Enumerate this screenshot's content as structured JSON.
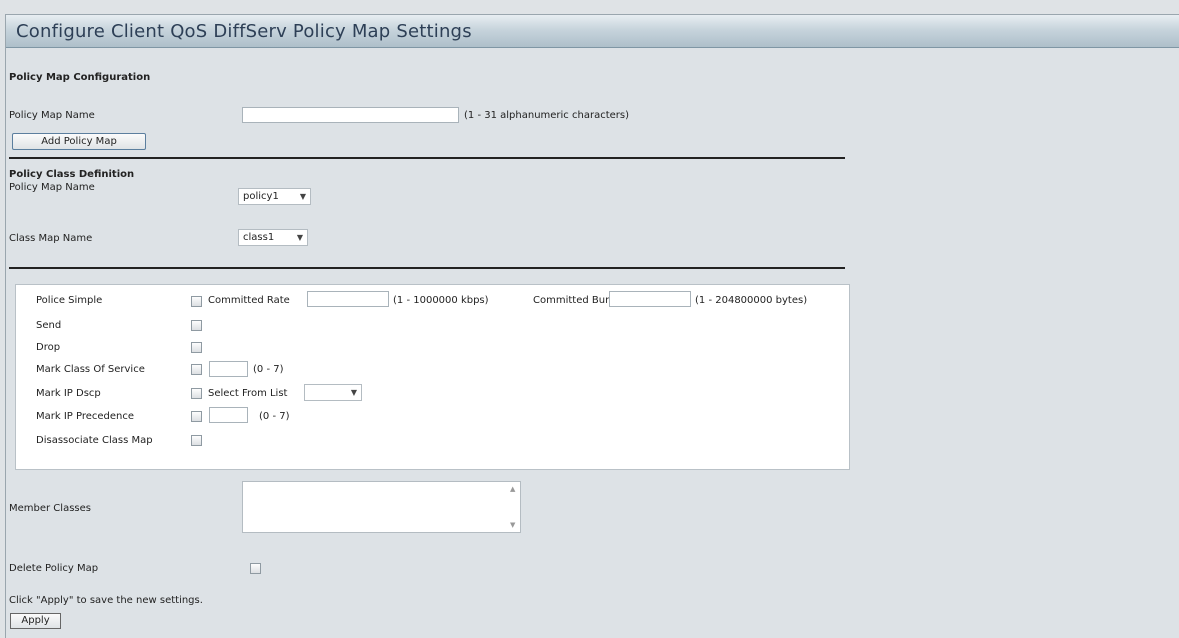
{
  "page": {
    "title": "Configure Client QoS DiffServ Policy Map Settings"
  },
  "policy_map_config": {
    "heading": "Policy Map Configuration",
    "name_label": "Policy Map Name",
    "name_value": "",
    "name_hint": "(1 - 31 alphanumeric characters)",
    "add_button": "Add Policy Map"
  },
  "class_definition": {
    "heading": "Policy Class Definition",
    "policy_label": "Policy Map Name",
    "policy_selected": "policy1",
    "class_label": "Class Map Name",
    "class_selected": "class1"
  },
  "actions": {
    "police_simple": {
      "label": "Police Simple",
      "committed_rate_label": "Committed Rate",
      "committed_rate_value": "",
      "committed_rate_hint": "(1 - 1000000 kbps)",
      "committed_burst_label": "Committed Burst",
      "committed_burst_value": "",
      "committed_burst_hint": "(1 - 204800000 bytes)"
    },
    "send": {
      "label": "Send"
    },
    "drop": {
      "label": "Drop"
    },
    "mark_cos": {
      "label": "Mark Class Of Service",
      "value": "",
      "hint": "(0 - 7)"
    },
    "mark_dscp": {
      "label": "Mark IP Dscp",
      "select_label": "Select From List",
      "selected": ""
    },
    "mark_precedence": {
      "label": "Mark IP Precedence",
      "value": "",
      "hint": "(0 - 7)"
    },
    "disassociate": {
      "label": "Disassociate Class Map"
    }
  },
  "member_classes": {
    "label": "Member Classes",
    "items": []
  },
  "delete": {
    "label": "Delete Policy Map"
  },
  "footer": {
    "note": "Click \"Apply\" to save the new settings.",
    "apply_button": "Apply"
  },
  "icons": {
    "dropdown": "chevron-down-icon",
    "scroll_up": "scroll-up-icon",
    "scroll_down": "scroll-down-icon"
  },
  "colors": {
    "title_text": "#2d3f56",
    "button_border": "#5b7e9e",
    "page_bg": "#dde2e6"
  }
}
